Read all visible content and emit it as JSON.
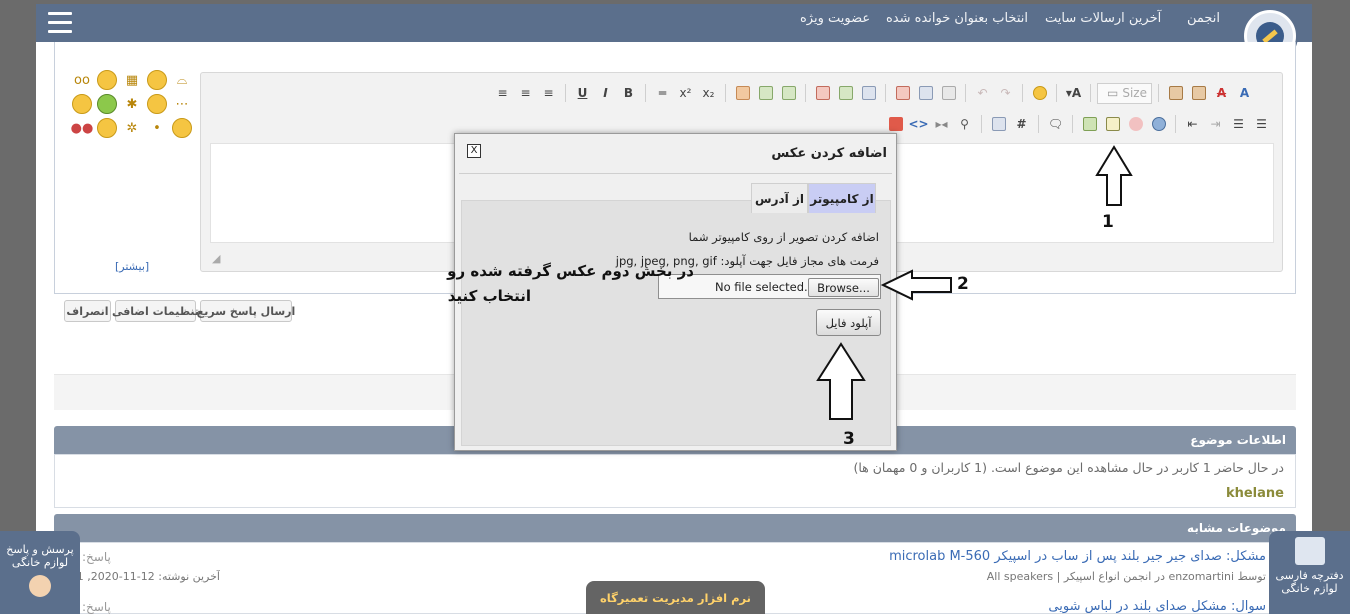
{
  "nav": {
    "links": [
      "انجمن",
      "آخرین ارسالات سایت",
      "انتخاب بعنوان خوانده شده",
      "عضویت ویژه"
    ]
  },
  "editor": {
    "size_label": "Size",
    "more_smilies": "[بیشتر]"
  },
  "actions": {
    "quick_reply": "ارسال پاسخ سریع",
    "advanced": "تنظیمات اضافی",
    "cancel": "انصراف"
  },
  "modal": {
    "title": "اضافه کردن عکس",
    "close": "X",
    "tab_computer": "از کامپیوتر",
    "tab_address": "از آدرس",
    "description": "اضافه کردن تصویر از روی کامپیوتر شما",
    "allowed_formats": "فرمت های مجاز فایل جهت آپلود: jpg, jpeg, png, gif",
    "browse_label": "Browse...",
    "file_status": "No file selected.",
    "upload_label": "آپلود فایل"
  },
  "annotations": {
    "step1": "1",
    "step2": "2",
    "step3": "3",
    "instruction_line1": "در بخش دوم عکس گرفته شده رو",
    "instruction_line2": "انتخاب کنید"
  },
  "topic_info": {
    "heading": "اطلاعات موضوع",
    "viewers_text": "در حال حاضر 1 کاربر در حال مشاهده این موضوع است. (1 کاربران و 0 مهمان ها)",
    "viewer_name": "khelane"
  },
  "similar": {
    "heading": "موضوعات مشابه",
    "items": [
      {
        "title": "مشکل: صدای جیر جیر بلند پس از ساب در اسپیکر microlab M-560",
        "meta": "توسط enzomartini در انجمن انواع اسپیکر | All speakers",
        "replies_label": "پاسخ:",
        "last_post": "آخرین نوشته: 12-11-2020, 01"
      },
      {
        "title": "سوال: مشکل صدای بلند در لباس شویی",
        "replies_label": "پاسخ:"
      }
    ]
  },
  "widgets": {
    "qa_line1": "پرسش و پاسخ",
    "qa_line2": "لوازم خانگی",
    "notebook_line1": "دفترچه فارسی",
    "notebook_line2": "لوازم خانگی"
  },
  "footer": {
    "software_label": "نرم افزار مدیریت تعمیرگاه"
  }
}
